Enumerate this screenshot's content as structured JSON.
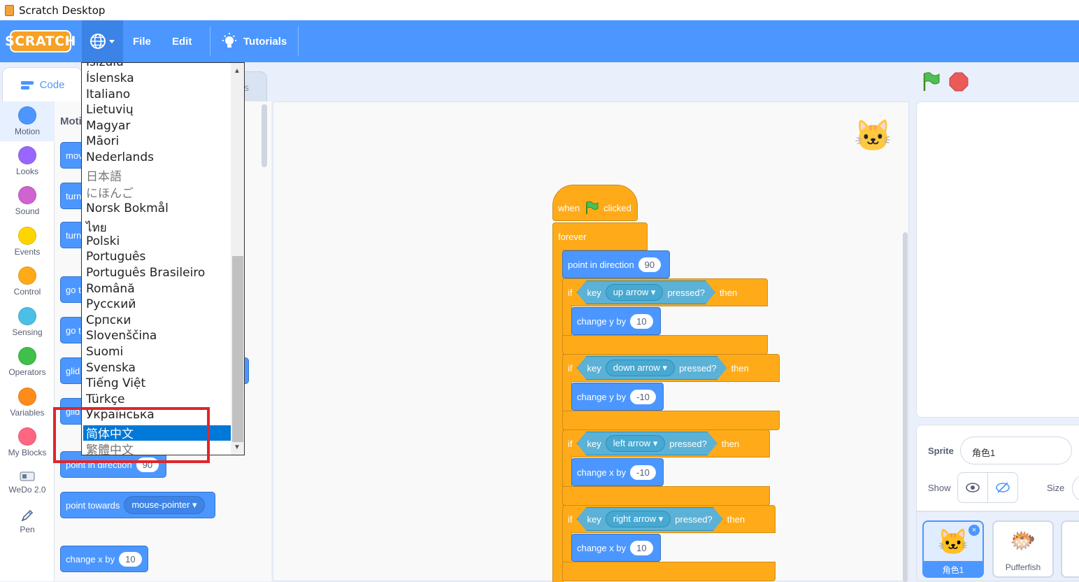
{
  "window": {
    "title": "Scratch Desktop"
  },
  "menubar": {
    "logo": "SCRATCH",
    "file": "File",
    "edit": "Edit",
    "tutorials": "Tutorials"
  },
  "tabs": {
    "code": "Code",
    "costumes_partial": "s"
  },
  "categories": [
    {
      "label": "Motion",
      "color": "#4c97ff"
    },
    {
      "label": "Looks",
      "color": "#9966ff"
    },
    {
      "label": "Sound",
      "color": "#cf63cf"
    },
    {
      "label": "Events",
      "color": "#ffd500"
    },
    {
      "label": "Control",
      "color": "#ffab19"
    },
    {
      "label": "Sensing",
      "color": "#4cbfe6"
    },
    {
      "label": "Operators",
      "color": "#40bf4a"
    },
    {
      "label": "Variables",
      "color": "#ff8c1a"
    },
    {
      "label": "My Blocks",
      "color": "#ff6680"
    },
    {
      "label": "WeDo 2.0",
      "color": ""
    },
    {
      "label": "Pen",
      "color": ""
    }
  ],
  "palette": {
    "title": "Moti",
    "blocks": [
      "mov",
      "turn",
      "turn",
      "go t",
      "go t",
      "glid",
      "glid",
      "point in direction",
      "point towards",
      "change x by"
    ],
    "direction_value": "90",
    "towards_value": "mouse-pointer",
    "change_x_value": "10"
  },
  "language_menu": {
    "items": [
      "Isizulu",
      "Íslenska",
      "Italiano",
      "Lietuvių",
      "Magyar",
      "Māori",
      "Nederlands",
      "日本語",
      "にほんご",
      "Norsk Bokmål",
      "ไทย",
      "Polski",
      "Português",
      "Português Brasileiro",
      "Română",
      "Русский",
      "Српски",
      "Slovenščina",
      "Suomi",
      "Svenska",
      "Tiếng Việt",
      "Türkçe",
      "Українська",
      "简体中文",
      "繁體中文"
    ],
    "selected": "简体中文"
  },
  "script": {
    "hat": {
      "when": "when",
      "clicked": "clicked"
    },
    "forever": "forever",
    "point_dir": {
      "label": "point in direction",
      "value": "90"
    },
    "if_word": "if",
    "then_word": "then",
    "key_word": "key",
    "pressed_word": "pressed?",
    "ifs": [
      {
        "key": "up arrow",
        "action": "change y by",
        "value": "10"
      },
      {
        "key": "down arrow",
        "action": "change y by",
        "value": "-10"
      },
      {
        "key": "left arrow",
        "action": "change x by",
        "value": "-10"
      },
      {
        "key": "right arrow",
        "action": "change x by",
        "value": "10"
      }
    ]
  },
  "sprite_info": {
    "sprite_label": "Sprite",
    "sprite_name": "角色1",
    "show_label": "Show",
    "size_label": "Size"
  },
  "sprites": [
    {
      "name": "角色1"
    },
    {
      "name": "Pufferfish"
    }
  ]
}
